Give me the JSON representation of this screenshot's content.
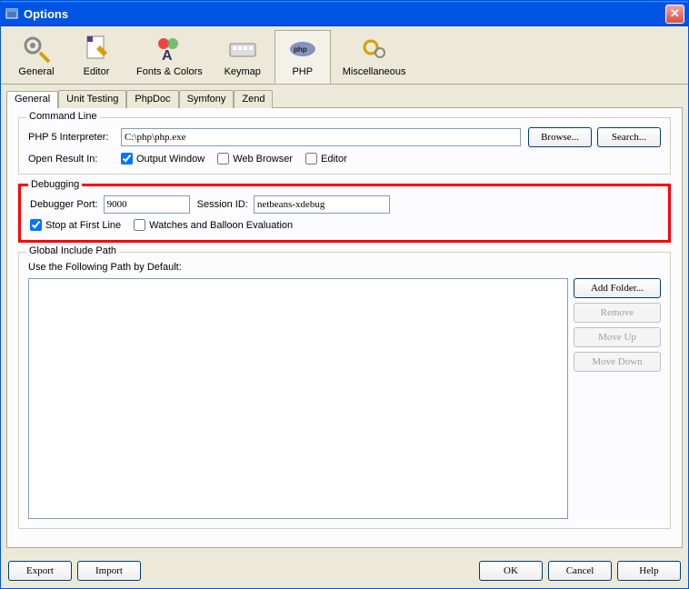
{
  "window": {
    "title": "Options"
  },
  "toolbar": [
    {
      "label": "General"
    },
    {
      "label": "Editor"
    },
    {
      "label": "Fonts & Colors"
    },
    {
      "label": "Keymap"
    },
    {
      "label": "PHP"
    },
    {
      "label": "Miscellaneous"
    }
  ],
  "toolbar_selected": 4,
  "tabs": [
    {
      "label": "General"
    },
    {
      "label": "Unit Testing"
    },
    {
      "label": "PhpDoc"
    },
    {
      "label": "Symfony"
    },
    {
      "label": "Zend"
    }
  ],
  "tab_selected": 0,
  "command_line": {
    "legend": "Command Line",
    "interpreter_label": "PHP 5 Interpreter:",
    "interpreter_value": "C:\\php\\php.exe",
    "browse_label": "Browse...",
    "search_label": "Search...",
    "open_result_label": "Open Result In:",
    "output_window_label": "Output Window",
    "output_window_checked": true,
    "web_browser_label": "Web Browser",
    "web_browser_checked": false,
    "editor_label": "Editor",
    "editor_checked": false
  },
  "debugging": {
    "legend": "Debugging",
    "port_label": "Debugger Port:",
    "port_value": "9000",
    "session_label": "Session ID:",
    "session_value": "netbeans-xdebug",
    "stop_first_label": "Stop at First Line",
    "stop_first_checked": true,
    "watches_label": "Watches and Balloon Evaluation",
    "watches_checked": false
  },
  "include_path": {
    "legend": "Global Include Path",
    "default_label": "Use the Following Path by Default:",
    "add_folder_label": "Add Folder...",
    "remove_label": "Remove",
    "move_up_label": "Move Up",
    "move_down_label": "Move Down"
  },
  "footer": {
    "export_label": "Export",
    "import_label": "Import",
    "ok_label": "OK",
    "cancel_label": "Cancel",
    "help_label": "Help"
  }
}
